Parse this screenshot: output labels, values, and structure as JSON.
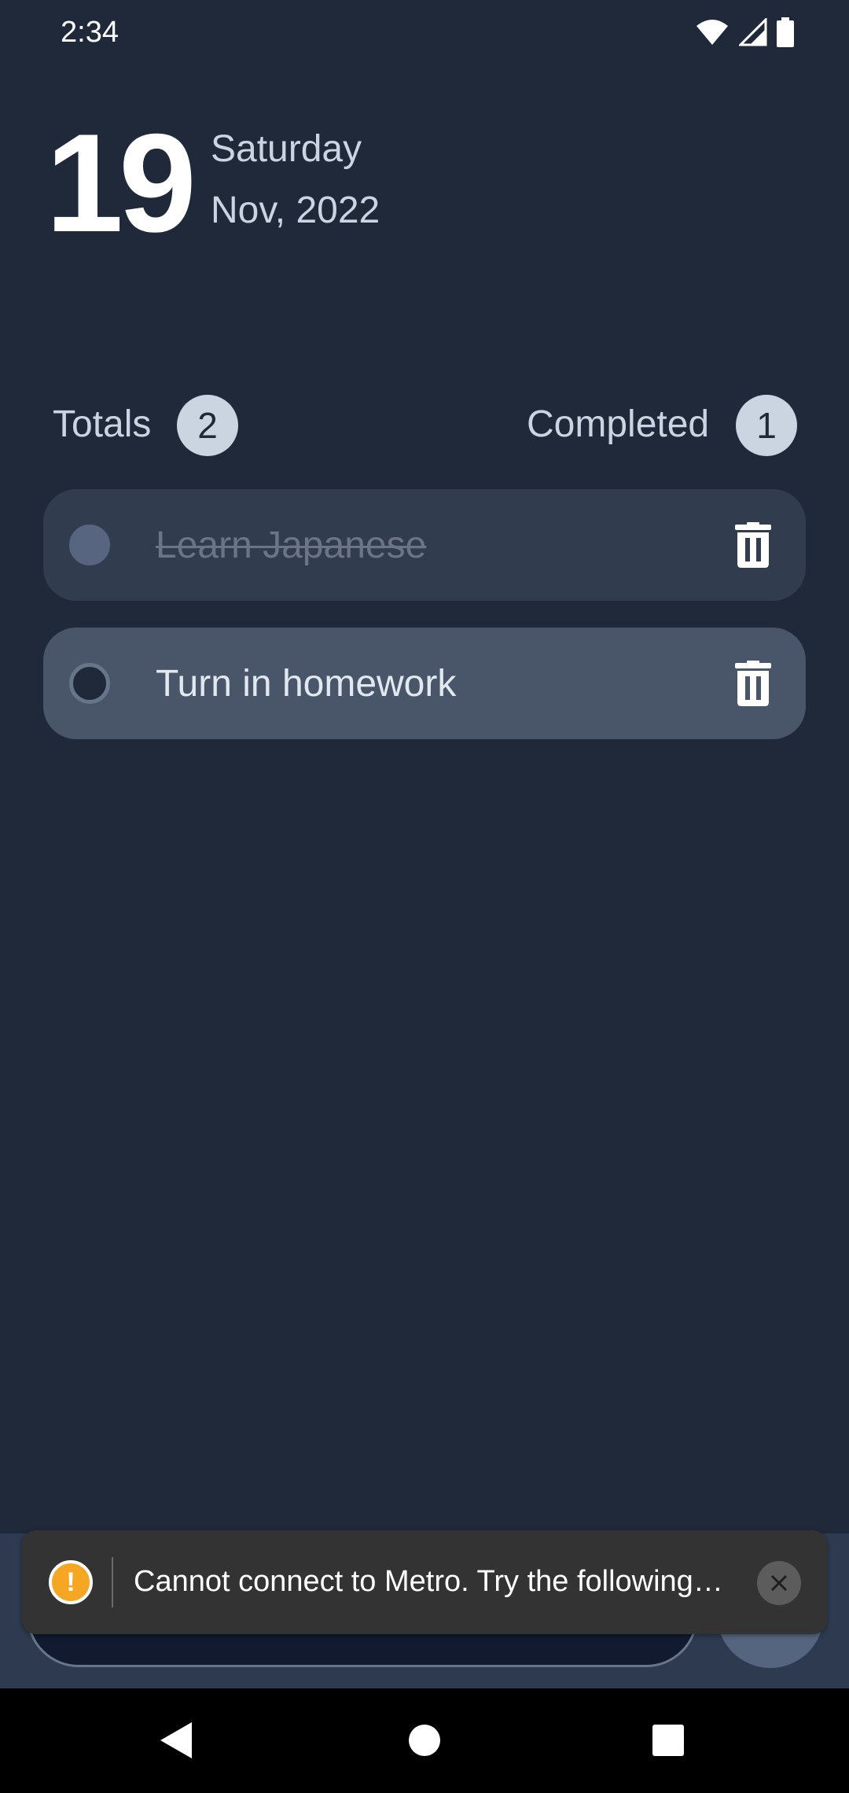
{
  "status_bar": {
    "time": "2:34",
    "icons": [
      "wifi-icon",
      "cell-signal-icon",
      "battery-icon"
    ]
  },
  "header": {
    "day": "19",
    "weekday": "Saturday",
    "month_year": "Nov, 2022"
  },
  "stats": {
    "totals_label": "Totals",
    "totals_count": "2",
    "completed_label": "Completed",
    "completed_count": "1"
  },
  "tasks": [
    {
      "title": "Learn Japanese",
      "completed": true
    },
    {
      "title": "Turn in homework",
      "completed": false
    }
  ],
  "toast": {
    "message": "Cannot connect to Metro.  Try the following…",
    "icon": "warning-icon",
    "close_icon": "close-icon"
  },
  "colors": {
    "background": "#1f293a",
    "task_done_bg": "#323c4f",
    "task_open_bg": "#495669",
    "badge": "#cbd5e1",
    "warning": "#f5a623"
  }
}
